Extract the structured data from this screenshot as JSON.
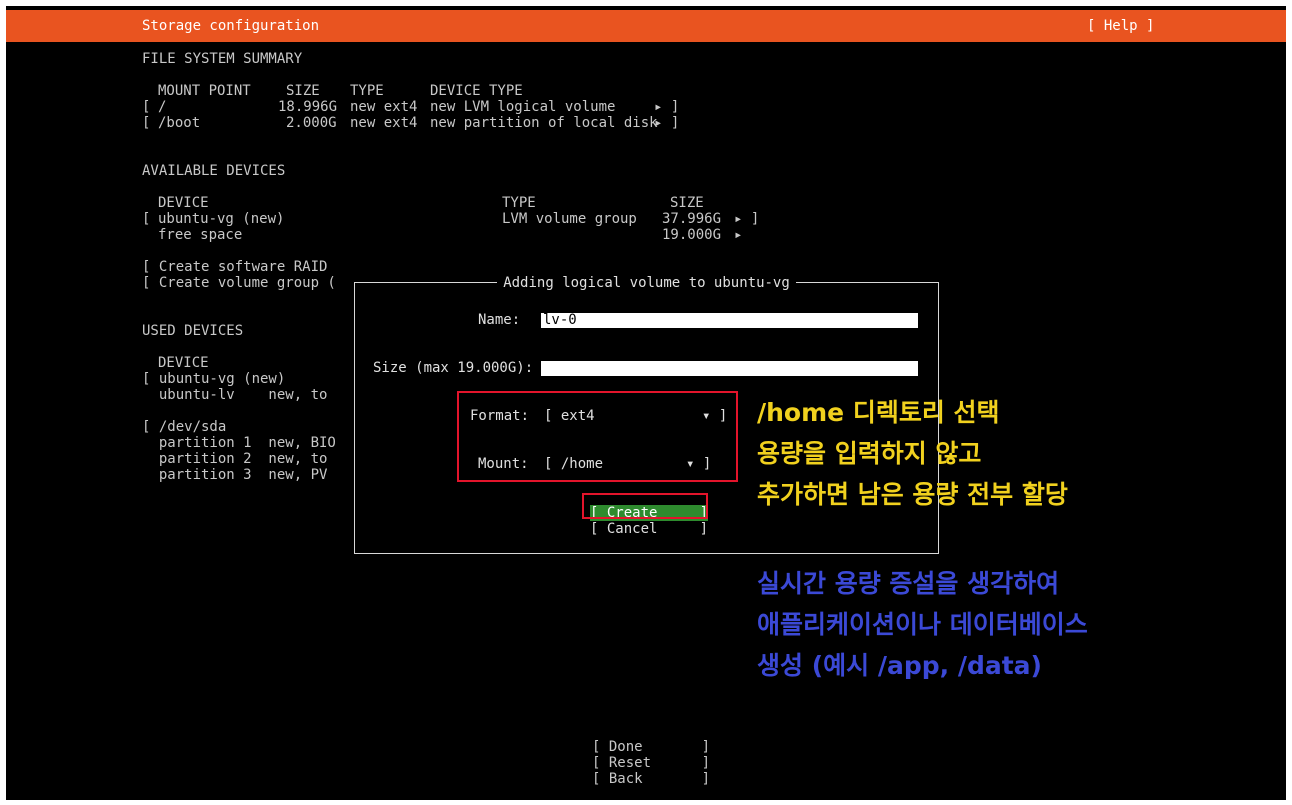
{
  "header": {
    "title": "Storage configuration",
    "help": "[ Help ]"
  },
  "fs_summary": {
    "heading": "FILE SYSTEM SUMMARY",
    "columns": [
      "MOUNT POINT",
      "SIZE",
      "TYPE",
      "DEVICE TYPE"
    ],
    "rows": [
      {
        "open": "[",
        "mount": "/",
        "size": "18.996G",
        "type": "new ext4",
        "device_type": "new LVM logical volume",
        "arrow": "▸ ]"
      },
      {
        "open": "[",
        "mount": "/boot",
        "size": "2.000G",
        "type": "new ext4",
        "device_type": "new partition of local disk",
        "arrow": "▸ ]"
      }
    ]
  },
  "available_devices": {
    "heading": "AVAILABLE DEVICES",
    "columns": [
      "DEVICE",
      "TYPE",
      "SIZE"
    ],
    "rows": [
      {
        "open": "[",
        "device": "ubuntu-vg (new)",
        "type": "LVM volume group",
        "size": "37.996G",
        "arrow": "▸ ]"
      },
      {
        "open": "",
        "device": "free space",
        "type": "",
        "size": "19.000G",
        "arrow": "▸"
      }
    ],
    "actions": [
      "[ Create software RAID",
      "[ Create volume group ("
    ]
  },
  "used_devices": {
    "heading": "USED DEVICES",
    "column": "DEVICE",
    "lines": [
      "[ ubuntu-vg (new)",
      "  ubuntu-lv    new, to",
      "",
      "[ /dev/sda",
      "  partition 1  new, BIO",
      "  partition 2  new, to",
      "  partition 3  new, PV"
    ]
  },
  "dialog": {
    "title": "Adding logical volume to ubuntu-vg",
    "name_label": "Name:",
    "name_value": "lv-0",
    "size_label": "Size (max 19.000G):",
    "size_value": "",
    "format_label": "Format:",
    "format_value": "[ ext4",
    "format_arrow": "▾ ]",
    "mount_label": "Mount:",
    "mount_value": "[ /home",
    "mount_arrow": "▾ ]",
    "create_label": "[ Create     ]",
    "cancel_label": "[ Cancel     ]"
  },
  "footer": {
    "done": "[ Done       ]",
    "reset": "[ Reset      ]",
    "back": "[ Back       ]"
  },
  "annotations": {
    "yellow": [
      "/home 디렉토리 선택",
      "용량을 입력하지 않고",
      "추가하면 남은 용량 전부 할당"
    ],
    "blue": [
      "실시간 용량 증설을 생각하여",
      "애플리케이션이나 데이터베이스",
      "생성 (예시 /app, /data)"
    ]
  },
  "colors": {
    "accent": "#e95420",
    "highlight_box": "#e3142b",
    "create_button": "#2e8b2e",
    "note_yellow": "#f1d11e",
    "note_blue": "#3b49d6"
  }
}
